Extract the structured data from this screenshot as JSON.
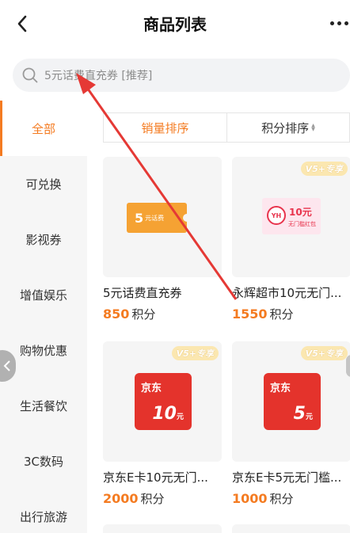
{
  "header": {
    "title": "商品列表"
  },
  "search": {
    "placeholder": "5元话费直充券 [推荐]"
  },
  "sidebar": {
    "items": [
      {
        "label": "全部",
        "active": true
      },
      {
        "label": "可兑换"
      },
      {
        "label": "影视券"
      },
      {
        "label": "增值娱乐"
      },
      {
        "label": "购物优惠"
      },
      {
        "label": "生活餐饮"
      },
      {
        "label": "3C数码"
      },
      {
        "label": "出行旅游"
      }
    ]
  },
  "sort": {
    "sales": "销量排序",
    "points": "积分排序"
  },
  "badge_text": "V5+专享",
  "products": [
    {
      "name": "5元话费直充券",
      "price": "850",
      "unit": "积分",
      "image": {
        "big": "5",
        "small": "元话费"
      }
    },
    {
      "name": "永辉超市10元无门...",
      "price": "1550",
      "unit": "积分",
      "image": {
        "logo": "YH",
        "amount": "10元",
        "caption": "无门槛红包"
      }
    },
    {
      "name": "京东E卡10元无门...",
      "price": "2000",
      "unit": "积分",
      "image": {
        "brand": "京东",
        "value": "10",
        "unit": "元"
      }
    },
    {
      "name": "京东E卡5元无门槛...",
      "price": "1000",
      "unit": "积分",
      "image": {
        "brand": "京东",
        "value": "5",
        "unit": "元"
      }
    }
  ],
  "colors": {
    "accent": "#f47b21",
    "annotation_arrow": "#e53935"
  }
}
